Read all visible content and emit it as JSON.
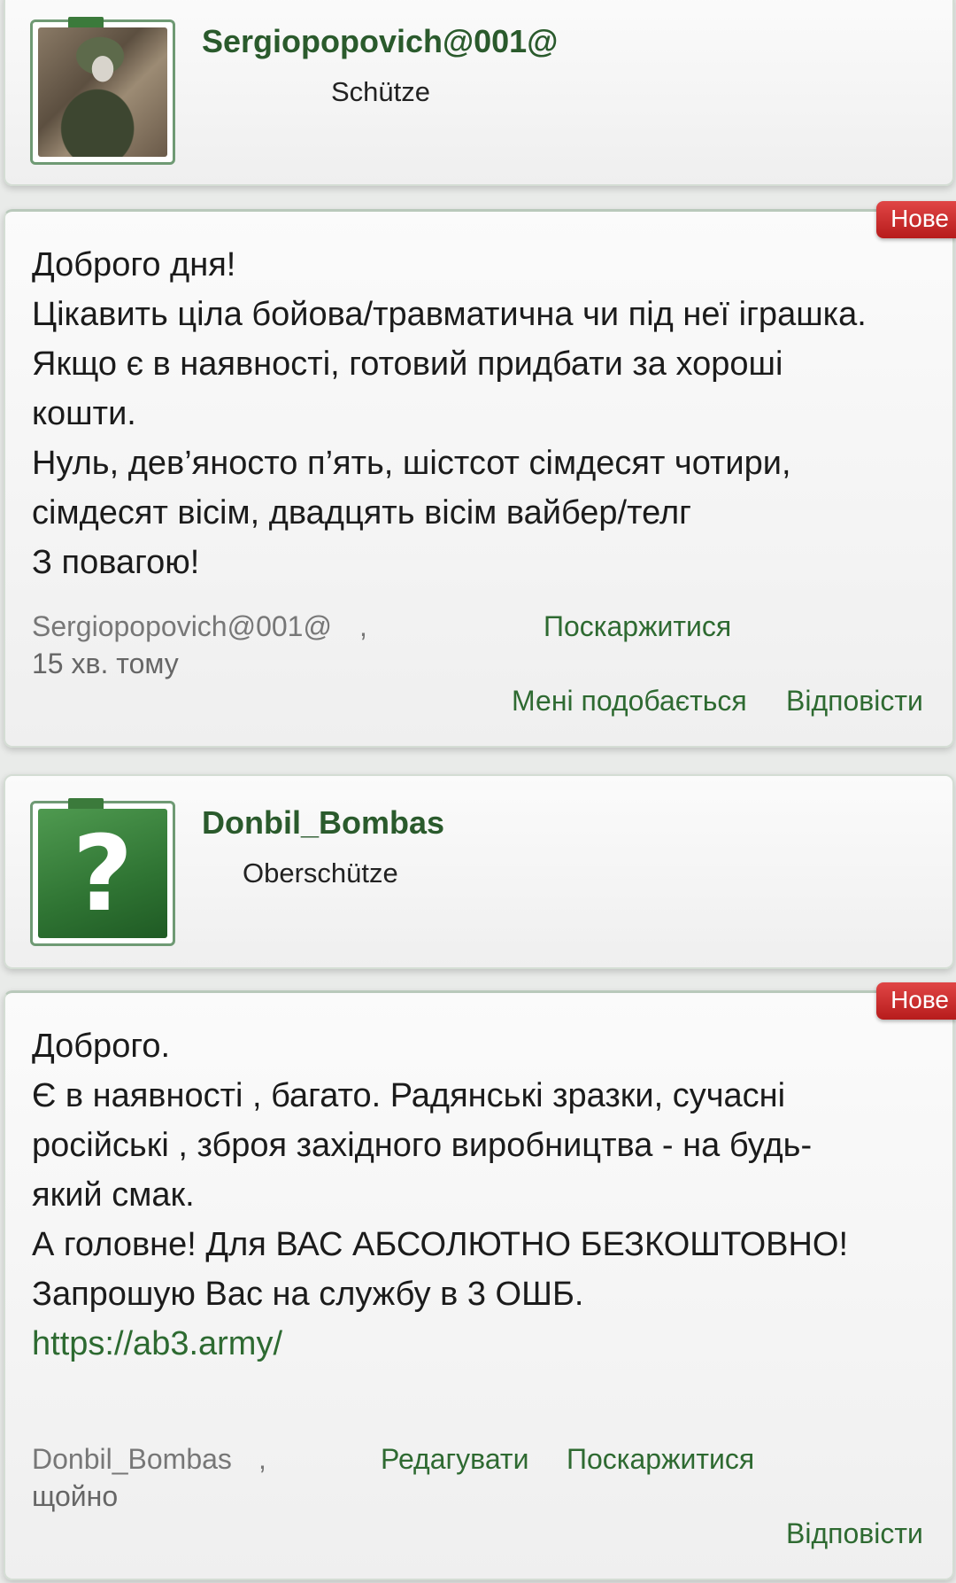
{
  "posts": [
    {
      "username": "Sergiopopovich@001@",
      "rank": "Schütze",
      "badge": "Нове",
      "lines": [
        "Доброго дня!",
        "Цікавить ціла бойова/травматична чи під неї іграшка.",
        "Якщо є в наявності, готовий придбати за хороші",
        "кошти.",
        "Нуль, дев’яносто п’ять, шістсот сімдесят чотири,",
        "сімдесят вісім, двадцять вісім вайбер/телг",
        "З повагою!"
      ],
      "meta_author": "Sergiopopovich@001@",
      "meta_sep": ",",
      "time": "15 хв. тому",
      "report_label": "Поскаржитися",
      "like_label": "Мені подобається",
      "reply_label": "Відповісти"
    },
    {
      "username": "Donbil_Bombas",
      "rank": "Oberschütze",
      "badge": "Нове",
      "lines": [
        "Доброго.",
        "Є в наявності , багато. Радянські зразки, сучасні",
        "російські , зброя західного виробництва - на будь-",
        "який смак.",
        "",
        "А головне! Для ВАС АБСОЛЮТНО БЕЗКОШТОВНО!",
        "Запрошую Вас на службу в 3 ОШБ."
      ],
      "link": "https://ab3.army/",
      "meta_author": "Donbil_Bombas",
      "meta_sep": ",",
      "time": "щойно",
      "edit_label": "Редагувати",
      "report_label": "Поскаржитися",
      "reply_label": "Відповісти"
    }
  ],
  "colors": {
    "accent_green": "#2e6a31",
    "badge_red": "#c62828"
  },
  "icons": {
    "avatar_placeholder": "question-mark-icon"
  }
}
